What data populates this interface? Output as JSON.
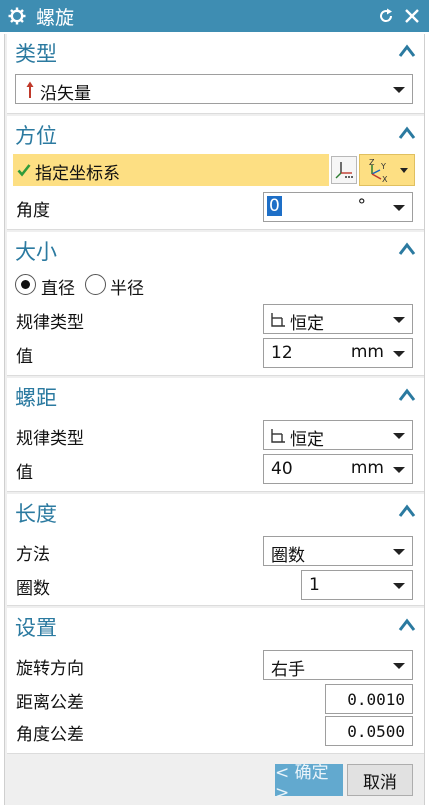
{
  "window": {
    "title": "螺旋"
  },
  "groups": {
    "type": {
      "title": "类型",
      "selection": "沿矢量"
    },
    "orientation": {
      "title": "方位",
      "specify_csys": "指定坐标系",
      "angle_label": "角度",
      "angle_value": "0",
      "angle_unit": "°"
    },
    "size": {
      "title": "大小",
      "radio_diameter": "直径",
      "radio_radius": "半径",
      "selected": "diameter",
      "law_label": "规律类型",
      "law_value": "恒定",
      "value_label": "值",
      "value": "12",
      "unit": "mm"
    },
    "pitch": {
      "title": "螺距",
      "law_label": "规律类型",
      "law_value": "恒定",
      "value_label": "值",
      "value": "40",
      "unit": "mm"
    },
    "length": {
      "title": "长度",
      "method_label": "方法",
      "method_value": "圈数",
      "turns_label": "圈数",
      "turns_value": "1"
    },
    "settings": {
      "title": "设置",
      "direction_label": "旋转方向",
      "direction_value": "右手",
      "dist_tol_label": "距离公差",
      "dist_tol_value": "0.0010",
      "angle_tol_label": "角度公差",
      "angle_tol_value": "0.0500"
    }
  },
  "buttons": {
    "ok": "< 确定 >",
    "cancel": "取消"
  },
  "colors": {
    "titlebar": "#3e8db2",
    "group_title": "#2b7aa0",
    "highlight_row": "#fddf83",
    "ok_button": "#62a9cf"
  }
}
